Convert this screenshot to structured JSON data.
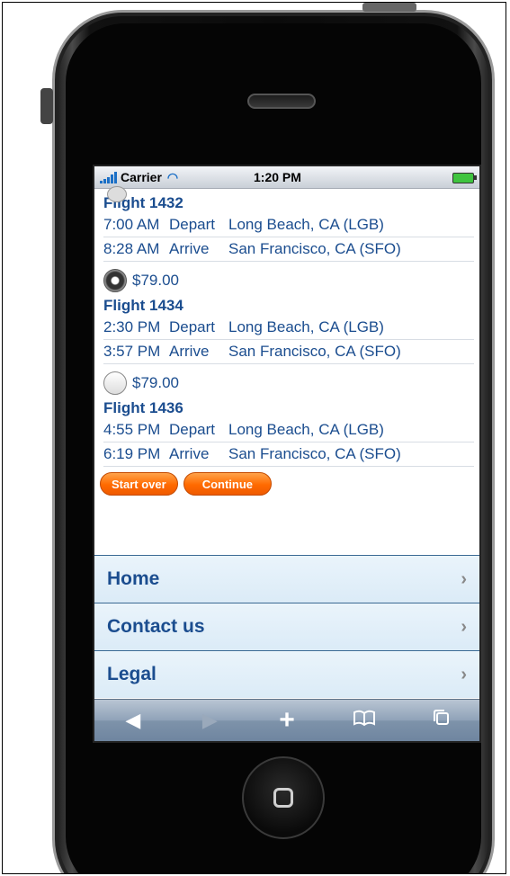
{
  "status_bar": {
    "carrier": "Carrier",
    "time": "1:20 PM"
  },
  "flights": [
    {
      "title": "Flight 1432",
      "legs": [
        {
          "time": "7:00 AM",
          "action": "Depart",
          "place": "Long Beach, CA (LGB)"
        },
        {
          "time": "8:28 AM",
          "action": "Arrive",
          "place": "San Francisco, CA (SFO)"
        }
      ]
    },
    {
      "price": "$79.00",
      "selected": true,
      "title": "Flight 1434",
      "legs": [
        {
          "time": "2:30 PM",
          "action": "Depart",
          "place": "Long Beach, CA (LGB)"
        },
        {
          "time": "3:57 PM",
          "action": "Arrive",
          "place": "San Francisco, CA (SFO)"
        }
      ]
    },
    {
      "price": "$79.00",
      "selected": false,
      "title": "Flight 1436",
      "legs": [
        {
          "time": "4:55 PM",
          "action": "Depart",
          "place": "Long Beach, CA (LGB)"
        },
        {
          "time": "6:19 PM",
          "action": "Arrive",
          "place": "San Francisco, CA (SFO)"
        }
      ]
    }
  ],
  "actions": {
    "start_over": "Start over",
    "continue": "Continue"
  },
  "nav": [
    {
      "label": "Home"
    },
    {
      "label": "Contact us"
    },
    {
      "label": "Legal"
    }
  ],
  "toolbar": {
    "back_icon": "back-arrow-icon",
    "forward_icon": "forward-arrow-icon",
    "add_icon": "plus-icon",
    "bookmarks_icon": "bookmarks-icon",
    "pages_icon": "pages-icon"
  }
}
